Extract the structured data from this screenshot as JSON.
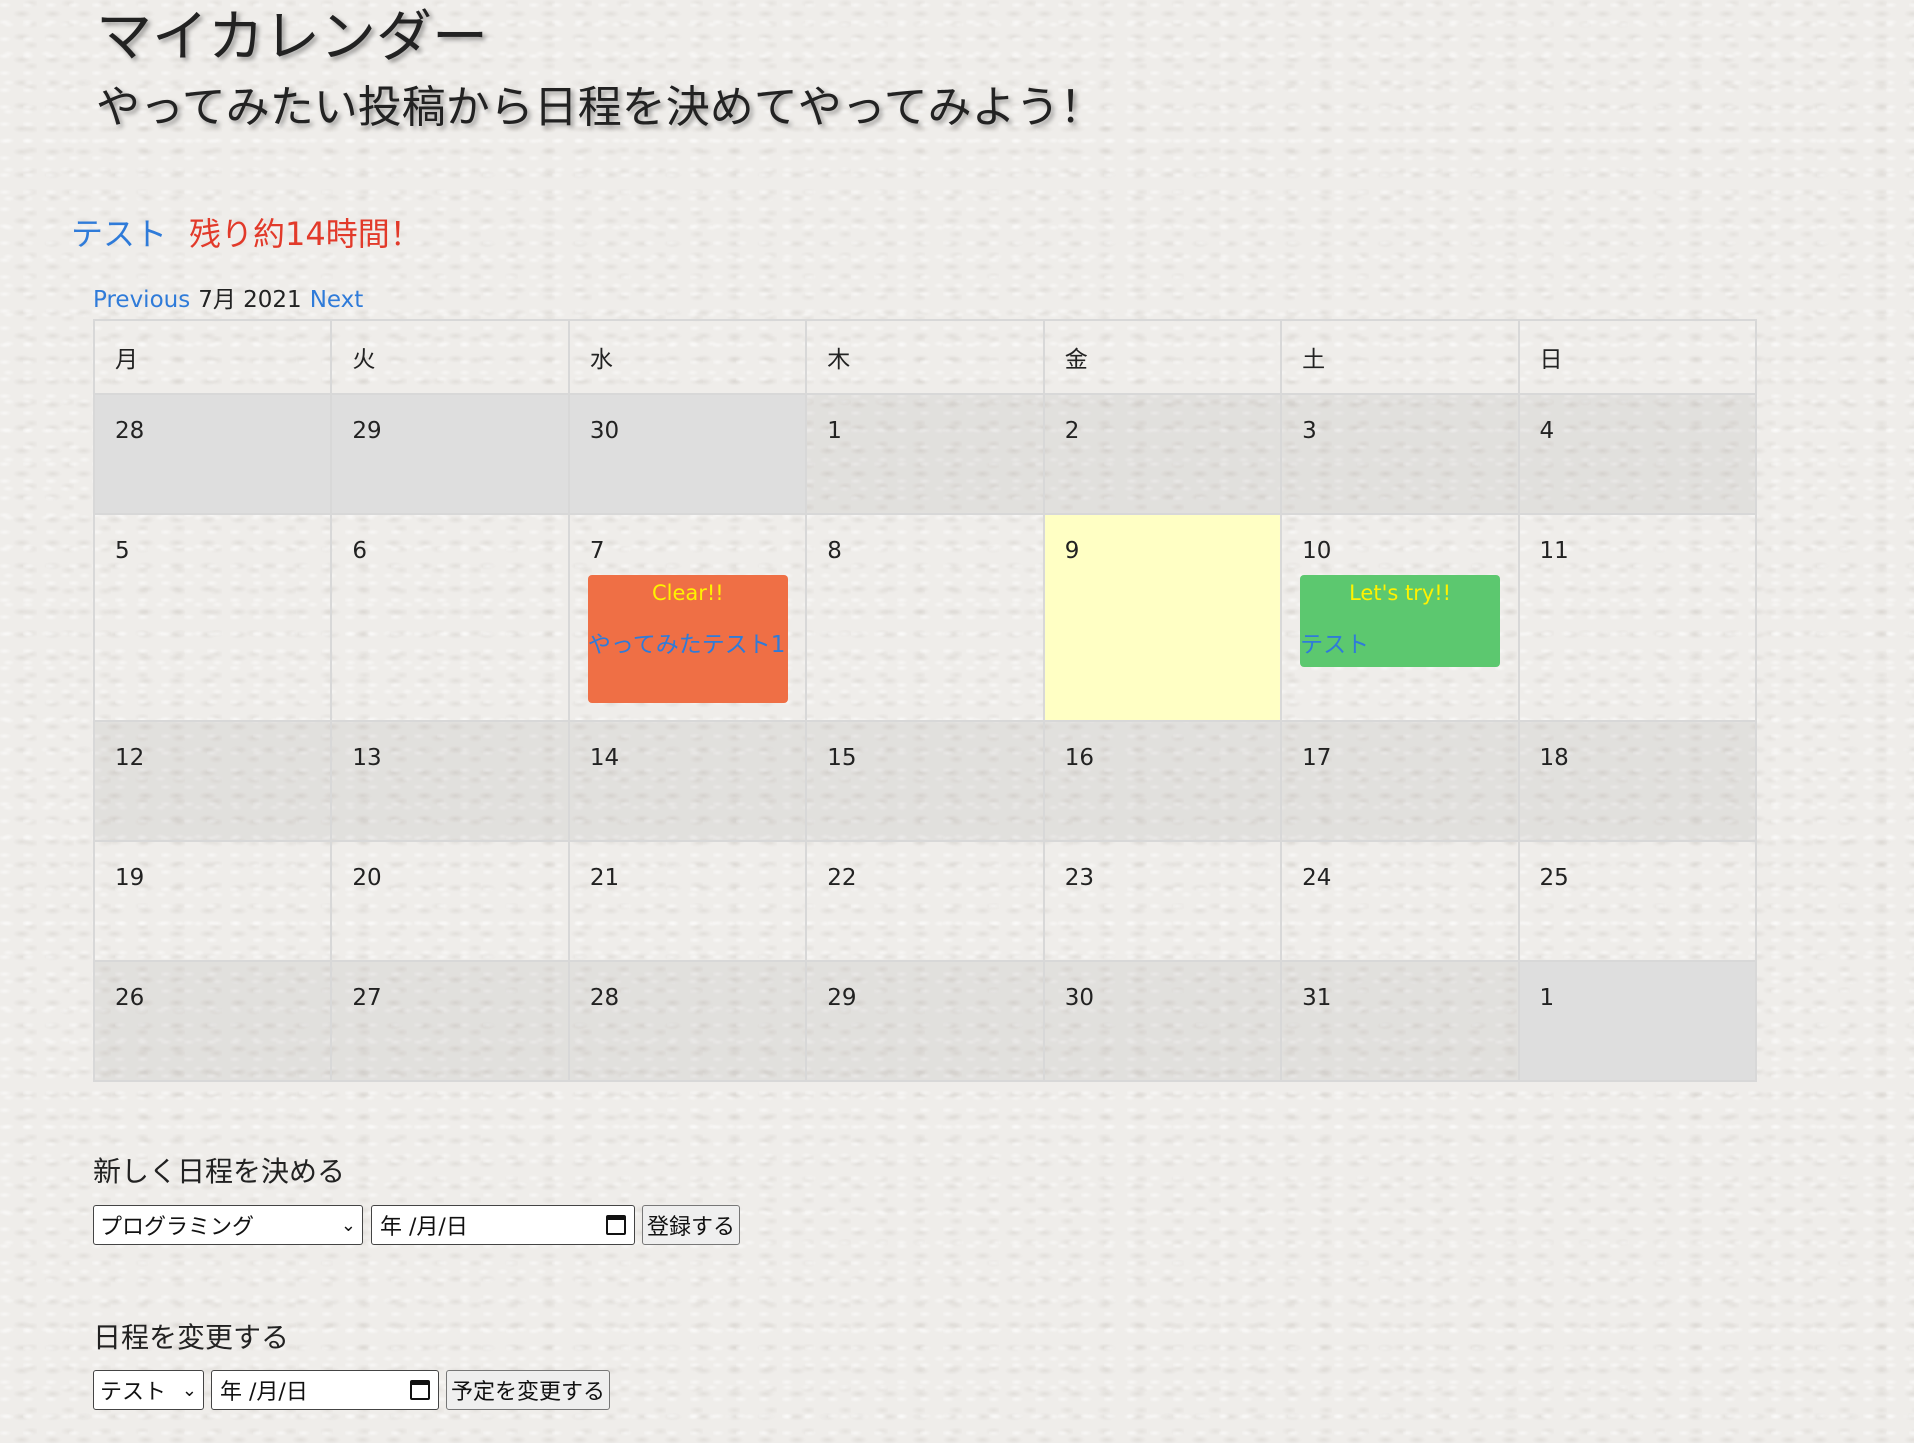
{
  "header": {
    "title": "マイカレンダー",
    "subtitle": "やってみたい投稿から日程を決めてやってみよう！"
  },
  "countdown": {
    "task": "テスト",
    "remaining": "残り約14時間！"
  },
  "month_nav": {
    "previous": "Previous",
    "month": "7月 2021",
    "next": "Next"
  },
  "calendar": {
    "weekdays": [
      "月",
      "火",
      "水",
      "木",
      "金",
      "土",
      "日"
    ],
    "weeks": [
      [
        "28",
        "29",
        "30",
        "1",
        "2",
        "3",
        "4"
      ],
      [
        "5",
        "6",
        "7",
        "8",
        "9",
        "10",
        "11"
      ],
      [
        "12",
        "13",
        "14",
        "15",
        "16",
        "17",
        "18"
      ],
      [
        "19",
        "20",
        "21",
        "22",
        "23",
        "24",
        "25"
      ],
      [
        "26",
        "27",
        "28",
        "29",
        "30",
        "31",
        "1"
      ]
    ],
    "events": {
      "clear": {
        "badge": "Clear!!",
        "title": "やってみたテスト1",
        "color": "#ef6f45"
      },
      "try": {
        "badge": "Let's try!!",
        "title": "テスト",
        "color": "#5cc86f"
      }
    },
    "today_color": "#ffffc4"
  },
  "new_schedule": {
    "heading": "新しく日程を決める",
    "select_value": "プログラミング",
    "date_placeholder": "年 /月/日",
    "submit": "登録する"
  },
  "change_schedule": {
    "heading": "日程を変更する",
    "select_value": "テスト",
    "date_placeholder": "年 /月/日",
    "submit": "予定を変更する"
  },
  "colors": {
    "link": "#2f7bd9",
    "alert": "#e23a2a",
    "badge_text": "#fff200"
  }
}
